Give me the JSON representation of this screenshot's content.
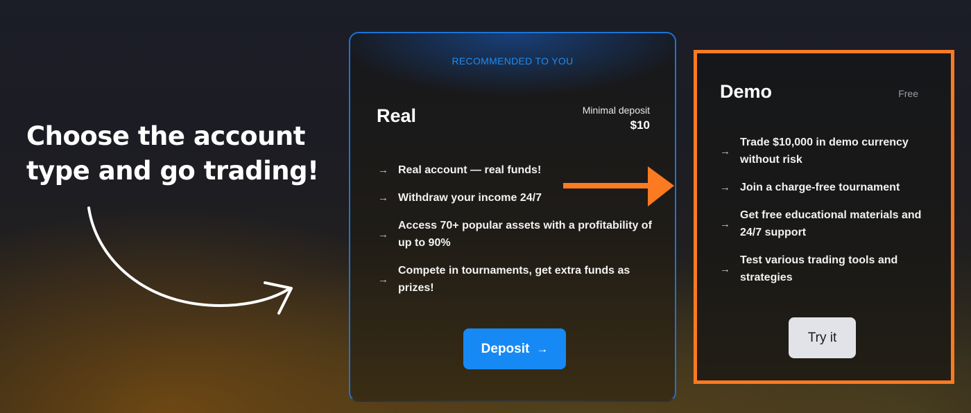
{
  "headline": "Choose the account type and go trading!",
  "real_card": {
    "badge": "RECOMMENDED TO YOU",
    "title": "Real",
    "min_deposit_label": "Minimal deposit",
    "min_deposit_value": "$10",
    "features": [
      "Real account — real funds!",
      "Withdraw your income 24/7",
      "Access 70+ popular assets with a profitability of up to 90%",
      "Compete in tournaments, get extra funds as prizes!"
    ],
    "button_label": "Deposit",
    "button_icon": "arrow-right-icon",
    "accent_color": "#1789f5"
  },
  "demo_card": {
    "title": "Demo",
    "price_label": "Free",
    "features": [
      "Trade $10,000 in demo currency without risk",
      "Join a charge-free tournament",
      "Get free educational materials and 24/7 support",
      "Test various trading tools and strategies"
    ],
    "button_label": "Try it",
    "highlight_color": "#fb7a22"
  },
  "icons": {
    "list_bullet": "arrow-right-icon",
    "pointer": "orange-arrow-icon",
    "curved": "curved-arrow-icon"
  }
}
